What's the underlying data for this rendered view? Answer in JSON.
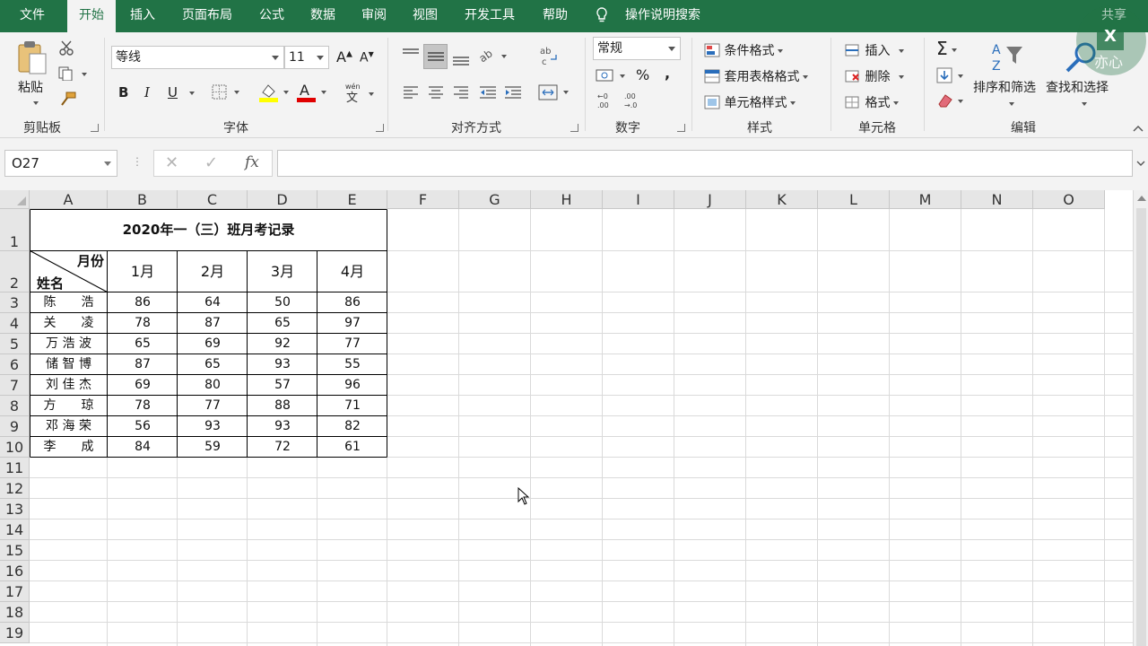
{
  "tabs": [
    "文件",
    "开始",
    "插入",
    "页面布局",
    "公式",
    "数据",
    "审阅",
    "视图",
    "开发工具",
    "帮助"
  ],
  "tell_me": "操作说明搜索",
  "share": "共享",
  "watermark": "亦心",
  "ribbon": {
    "clipboard": {
      "paste": "粘贴",
      "label": "剪贴板"
    },
    "font": {
      "name": "等线",
      "size": "11",
      "label": "字体",
      "phonetic": "wén"
    },
    "alignment": {
      "label": "对齐方式"
    },
    "number": {
      "format": "常规",
      "percent": "%",
      "comma": ",",
      "label": "数字"
    },
    "styles": {
      "conditional": "条件格式",
      "table": "套用表格格式",
      "cell": "单元格样式",
      "label": "样式"
    },
    "cells": {
      "insert": "插入",
      "delete": "删除",
      "format": "格式",
      "label": "单元格"
    },
    "editing": {
      "sort": "排序和筛选",
      "find": "查找和选择",
      "label": "编辑"
    }
  },
  "name_box": "O27",
  "formula": "",
  "columns": [
    "A",
    "B",
    "C",
    "D",
    "E",
    "F",
    "G",
    "H",
    "I",
    "J",
    "K",
    "L",
    "M",
    "N",
    "O"
  ],
  "rows": [
    "1",
    "2",
    "3",
    "4",
    "5",
    "6",
    "7",
    "8",
    "9",
    "10",
    "11",
    "12",
    "13",
    "14",
    "15",
    "16",
    "17",
    "18",
    "19"
  ],
  "sheet": {
    "title": "2020年一（三）班月考记录",
    "header_month": "月份",
    "header_name": "姓名",
    "months": [
      "1月",
      "2月",
      "3月",
      "4月"
    ],
    "students": [
      {
        "name": "陈　　浩",
        "scores": [
          "86",
          "64",
          "50",
          "86"
        ]
      },
      {
        "name": "关　　凌",
        "scores": [
          "78",
          "87",
          "65",
          "97"
        ]
      },
      {
        "name": "万 浩 波",
        "scores": [
          "65",
          "69",
          "92",
          "77"
        ]
      },
      {
        "name": "储 智 博",
        "scores": [
          "87",
          "65",
          "93",
          "55"
        ]
      },
      {
        "name": "刘 佳 杰",
        "scores": [
          "69",
          "80",
          "57",
          "96"
        ]
      },
      {
        "name": "方　　琼",
        "scores": [
          "78",
          "77",
          "88",
          "71"
        ]
      },
      {
        "name": "邓 海 荣",
        "scores": [
          "56",
          "93",
          "93",
          "82"
        ]
      },
      {
        "name": "李　　成",
        "scores": [
          "84",
          "59",
          "72",
          "61"
        ]
      }
    ]
  },
  "colors": {
    "accent": "#217346",
    "ribbon_bg": "#f3f3f3",
    "font_color_red": "#e00000",
    "highlight_yellow": "#ffff00"
  }
}
